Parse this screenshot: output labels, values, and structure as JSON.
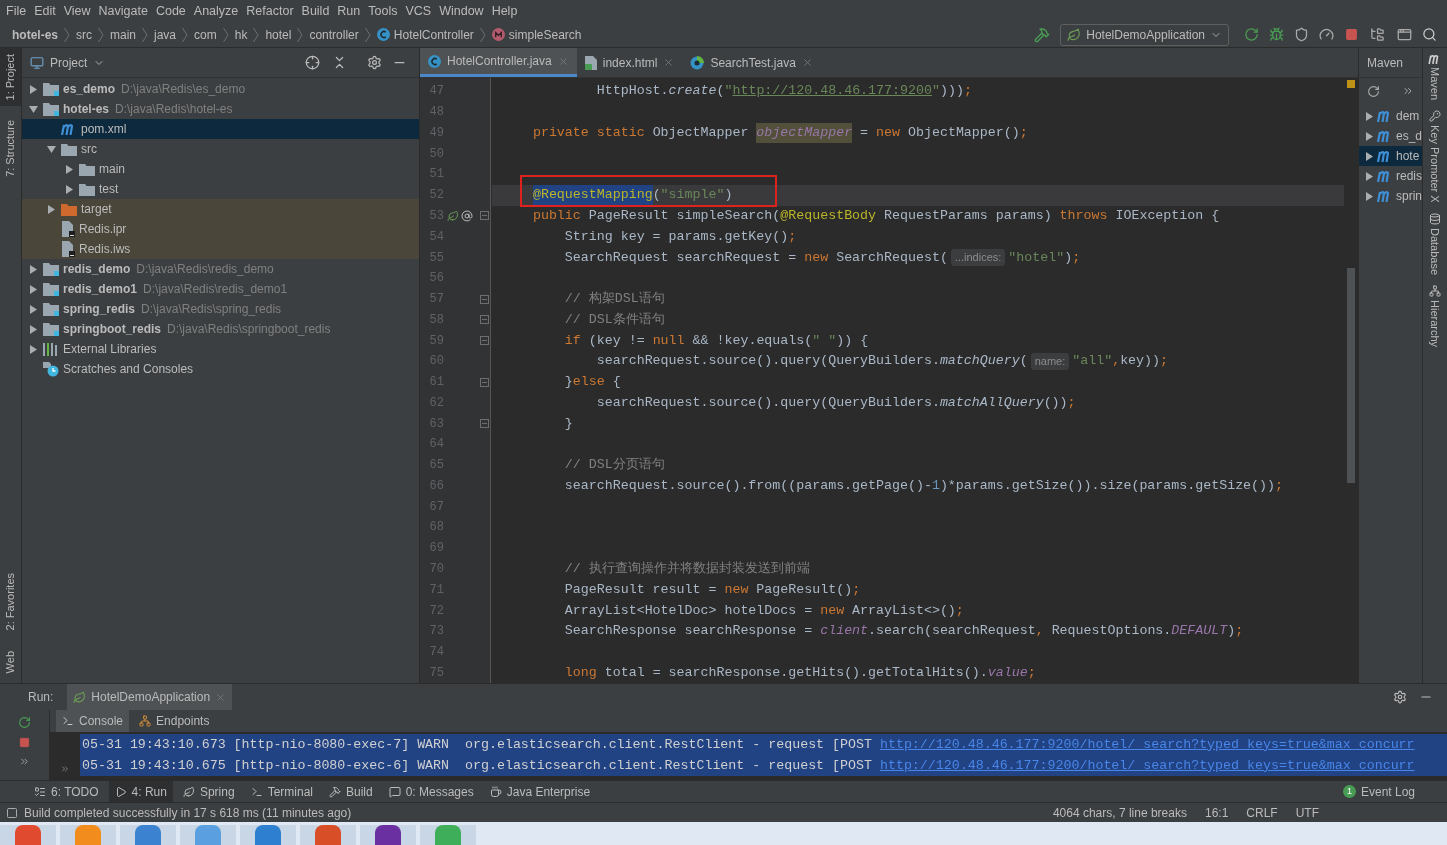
{
  "menu": [
    "File",
    "Edit",
    "View",
    "Navigate",
    "Code",
    "Analyze",
    "Refactor",
    "Build",
    "Run",
    "Tools",
    "VCS",
    "Window",
    "Help"
  ],
  "breadcrumbs": [
    {
      "label": "hotel-es",
      "kind": "module"
    },
    {
      "label": "src",
      "kind": "folder"
    },
    {
      "label": "main",
      "kind": "folder"
    },
    {
      "label": "java",
      "kind": "folder"
    },
    {
      "label": "com",
      "kind": "folder"
    },
    {
      "label": "hk",
      "kind": "folder"
    },
    {
      "label": "hotel",
      "kind": "folder"
    },
    {
      "label": "controller",
      "kind": "folder"
    },
    {
      "label": "HotelController",
      "kind": "class"
    },
    {
      "label": "simpleSearch",
      "kind": "method"
    }
  ],
  "run_config": {
    "label": "HotelDemoApplication"
  },
  "left_stripe_top": [
    {
      "label": "1: Project",
      "selected": true
    },
    {
      "label": "7: Structure",
      "selected": false
    }
  ],
  "left_stripe_bottom": [
    {
      "label": "2: Favorites",
      "selected": false
    },
    {
      "label": "Web",
      "selected": false
    }
  ],
  "project_panel": {
    "title": "Project",
    "tree": [
      {
        "name": "es_demo",
        "path": "D:\\java\\Redis\\es_demo",
        "kind": "module",
        "expanded": false,
        "selected": false,
        "highlighted": false
      },
      {
        "name": "hotel-es",
        "path": "D:\\java\\Redis\\hotel-es",
        "kind": "module",
        "expanded": true,
        "selected": false,
        "highlighted": false,
        "children": [
          {
            "name": "pom.xml",
            "kind": "maven",
            "selected": true,
            "highlighted": false
          },
          {
            "name": "src",
            "kind": "folder",
            "expanded": true,
            "selected": false,
            "highlighted": false,
            "children": [
              {
                "name": "main",
                "kind": "folder",
                "expanded": false,
                "selected": false,
                "highlighted": false
              },
              {
                "name": "test",
                "kind": "folder",
                "expanded": false,
                "selected": false,
                "highlighted": false
              }
            ]
          },
          {
            "name": "target",
            "kind": "excluded_folder",
            "expanded": false,
            "selected": false,
            "highlighted": true
          },
          {
            "name": "Redis.ipr",
            "kind": "ide_file",
            "selected": false,
            "highlighted": true
          },
          {
            "name": "Redis.iws",
            "kind": "ide_file",
            "selected": false,
            "highlighted": true
          }
        ]
      },
      {
        "name": "redis_demo",
        "path": "D:\\java\\Redis\\redis_demo",
        "kind": "module",
        "expanded": false,
        "selected": false,
        "highlighted": false
      },
      {
        "name": "redis_demo1",
        "path": "D:\\java\\Redis\\redis_demo1",
        "kind": "module",
        "expanded": false,
        "selected": false,
        "highlighted": false
      },
      {
        "name": "spring_redis",
        "path": "D:\\java\\Redis\\spring_redis",
        "kind": "module",
        "expanded": false,
        "selected": false,
        "highlighted": false
      },
      {
        "name": "springboot_redis",
        "path": "D:\\java\\Redis\\springboot_redis",
        "kind": "module",
        "expanded": false,
        "selected": false,
        "highlighted": false
      },
      {
        "name": "External Libraries",
        "kind": "libraries",
        "expanded": false,
        "selected": false,
        "highlighted": false
      },
      {
        "name": "Scratches and Consoles",
        "kind": "scratches",
        "selected": false,
        "highlighted": false
      }
    ]
  },
  "editor": {
    "tabs": [
      {
        "label": "HotelController.java",
        "kind": "class",
        "selected": true
      },
      {
        "label": "index.html",
        "kind": "html",
        "selected": false
      },
      {
        "label": "SearchTest.java",
        "kind": "test",
        "selected": false
      }
    ],
    "lines": [
      {
        "number": "47",
        "current": false,
        "fold": false,
        "tokens": [
          {
            "kind": "plain",
            "text": "            HttpHost."
          },
          {
            "kind": "italic",
            "text": "create"
          },
          {
            "kind": "plain",
            "text": "("
          },
          {
            "kind": "string",
            "text": "\""
          },
          {
            "kind": "url",
            "text": "http://120.48.46.177:9200"
          },
          {
            "kind": "string",
            "text": "\""
          },
          {
            "kind": "plain",
            "text": ")))"
          },
          {
            "kind": "keyword",
            "text": ";"
          }
        ]
      },
      {
        "number": "48",
        "current": false,
        "fold": false
      },
      {
        "number": "49",
        "current": false,
        "fold": false,
        "tokens": [
          {
            "kind": "keyword",
            "text": "    private static "
          },
          {
            "kind": "plain",
            "text": "ObjectMapper "
          },
          {
            "kind": "field_highlight",
            "text": "objectMapper"
          },
          {
            "kind": "plain",
            "text": " = "
          },
          {
            "kind": "keyword",
            "text": "new "
          },
          {
            "kind": "plain",
            "text": "ObjectMapper()"
          },
          {
            "kind": "keyword",
            "text": ";"
          }
        ]
      },
      {
        "number": "50",
        "current": false,
        "fold": false
      },
      {
        "number": "51",
        "current": false,
        "fold": false
      },
      {
        "number": "52",
        "current": true,
        "fold": false,
        "tokens": [
          {
            "kind": "annotation_selected",
            "text": "    @RequestMapping"
          },
          {
            "kind": "plain",
            "text": "("
          },
          {
            "kind": "string",
            "text": "\"simple\""
          },
          {
            "kind": "plain",
            "text": ")"
          }
        ]
      },
      {
        "number": "53",
        "current": false,
        "fold": true,
        "markers": true,
        "tokens": [
          {
            "kind": "keyword",
            "text": "    public "
          },
          {
            "kind": "plain",
            "text": "PageResult simpleSearch("
          },
          {
            "kind": "annotation",
            "text": "@RequestBody"
          },
          {
            "kind": "plain",
            "text": " RequestParams params) "
          },
          {
            "kind": "keyword",
            "text": "throws "
          },
          {
            "kind": "plain",
            "text": "IOException {"
          }
        ]
      },
      {
        "number": "54",
        "current": false,
        "fold": false,
        "tokens": [
          {
            "kind": "plain",
            "text": "        String key = params.getKey()"
          },
          {
            "kind": "keyword",
            "text": ";"
          }
        ]
      },
      {
        "number": "55",
        "current": false,
        "fold": false,
        "tokens": [
          {
            "kind": "plain",
            "text": "        SearchRequest searchRequest = "
          },
          {
            "kind": "keyword",
            "text": "new "
          },
          {
            "kind": "plain",
            "text": "SearchRequest("
          },
          {
            "kind": "hint",
            "text": "...indices:"
          },
          {
            "kind": "string",
            "text": "\"hotel\""
          },
          {
            "kind": "plain",
            "text": ")"
          },
          {
            "kind": "keyword",
            "text": ";"
          }
        ]
      },
      {
        "number": "56",
        "current": false,
        "fold": false
      },
      {
        "number": "57",
        "current": false,
        "fold": true,
        "tokens": [
          {
            "kind": "comment",
            "text": "        // 构架DSL语句"
          }
        ]
      },
      {
        "number": "58",
        "current": false,
        "fold": true,
        "tokens": [
          {
            "kind": "comment",
            "text": "        // DSL条件语句"
          }
        ]
      },
      {
        "number": "59",
        "current": false,
        "fold": true,
        "tokens": [
          {
            "kind": "keyword",
            "text": "        if "
          },
          {
            "kind": "plain",
            "text": "(key != "
          },
          {
            "kind": "keyword",
            "text": "null "
          },
          {
            "kind": "plain",
            "text": "&& !key.equals("
          },
          {
            "kind": "string",
            "text": "\" \""
          },
          {
            "kind": "plain",
            "text": ")) {"
          }
        ]
      },
      {
        "number": "60",
        "current": false,
        "fold": false,
        "tokens": [
          {
            "kind": "plain",
            "text": "            searchRequest.source().query(QueryBuilders."
          },
          {
            "kind": "italic",
            "text": "matchQuery"
          },
          {
            "kind": "plain",
            "text": "("
          },
          {
            "kind": "hint",
            "text": "name:"
          },
          {
            "kind": "string",
            "text": "\"all\""
          },
          {
            "kind": "keyword",
            "text": ","
          },
          {
            "kind": "plain",
            "text": "key))"
          },
          {
            "kind": "keyword",
            "text": ";"
          }
        ]
      },
      {
        "number": "61",
        "current": false,
        "fold": true,
        "tokens": [
          {
            "kind": "plain",
            "text": "        }"
          },
          {
            "kind": "keyword",
            "text": "else "
          },
          {
            "kind": "plain",
            "text": "{"
          }
        ]
      },
      {
        "number": "62",
        "current": false,
        "fold": false,
        "tokens": [
          {
            "kind": "plain",
            "text": "            searchRequest.source().query(QueryBuilders."
          },
          {
            "kind": "italic",
            "text": "matchAllQuery"
          },
          {
            "kind": "plain",
            "text": "())"
          },
          {
            "kind": "keyword",
            "text": ";"
          }
        ]
      },
      {
        "number": "63",
        "current": false,
        "fold": true,
        "tokens": [
          {
            "kind": "plain",
            "text": "        }"
          }
        ]
      },
      {
        "number": "64",
        "current": false,
        "fold": false
      },
      {
        "number": "65",
        "current": false,
        "fold": false,
        "tokens": [
          {
            "kind": "comment",
            "text": "        // DSL分页语句"
          }
        ]
      },
      {
        "number": "66",
        "current": false,
        "fold": false,
        "tokens": [
          {
            "kind": "plain",
            "text": "        searchRequest.source().from((params.getPage()-"
          },
          {
            "kind": "number",
            "text": "1"
          },
          {
            "kind": "plain",
            "text": ")*params.getSize()).size(params.getSize())"
          },
          {
            "kind": "keyword",
            "text": ";"
          }
        ]
      },
      {
        "number": "67",
        "current": false,
        "fold": false
      },
      {
        "number": "68",
        "current": false,
        "fold": false
      },
      {
        "number": "69",
        "current": false,
        "fold": false
      },
      {
        "number": "70",
        "current": false,
        "fold": false,
        "tokens": [
          {
            "kind": "comment",
            "text": "        // 执行查询操作并将数据封装发送到前端"
          }
        ]
      },
      {
        "number": "71",
        "current": false,
        "fold": false,
        "tokens": [
          {
            "kind": "plain",
            "text": "        PageResult result = "
          },
          {
            "kind": "keyword",
            "text": "new "
          },
          {
            "kind": "plain",
            "text": "PageResult()"
          },
          {
            "kind": "keyword",
            "text": ";"
          }
        ]
      },
      {
        "number": "72",
        "current": false,
        "fold": false,
        "tokens": [
          {
            "kind": "plain",
            "text": "        ArrayList<HotelDoc> hotelDocs = "
          },
          {
            "kind": "keyword",
            "text": "new "
          },
          {
            "kind": "plain",
            "text": "ArrayList<>()"
          },
          {
            "kind": "keyword",
            "text": ";"
          }
        ]
      },
      {
        "number": "73",
        "current": false,
        "fold": false,
        "tokens": [
          {
            "kind": "plain",
            "text": "        SearchResponse searchResponse = "
          },
          {
            "kind": "field",
            "text": "client"
          },
          {
            "kind": "plain",
            "text": ".search(searchRequest"
          },
          {
            "kind": "keyword",
            "text": ", "
          },
          {
            "kind": "plain",
            "text": "RequestOptions."
          },
          {
            "kind": "field",
            "text": "DEFAULT"
          },
          {
            "kind": "plain",
            "text": ")"
          },
          {
            "kind": "keyword",
            "text": ";"
          }
        ]
      },
      {
        "number": "74",
        "current": false,
        "fold": false
      },
      {
        "number": "75",
        "current": false,
        "fold": false,
        "tokens": [
          {
            "kind": "keyword",
            "text": "        long "
          },
          {
            "kind": "plain",
            "text": "total = searchResponse.getHits().getTotalHits()."
          },
          {
            "kind": "field",
            "text": "value"
          },
          {
            "kind": "keyword",
            "text": ";"
          }
        ]
      }
    ]
  },
  "maven": {
    "title": "Maven",
    "items": [
      {
        "label": "dem",
        "selected": false
      },
      {
        "label": "es_d",
        "selected": false
      },
      {
        "label": "hote",
        "selected": true
      },
      {
        "label": "redis",
        "selected": false
      },
      {
        "label": "sprin",
        "selected": false
      }
    ]
  },
  "right_stripe": [
    {
      "label": "Maven",
      "kind": "maven"
    },
    {
      "label": "Key Promoter X",
      "kind": "key"
    },
    {
      "label": "Database",
      "kind": "database"
    },
    {
      "label": "Hierarchy",
      "kind": "hierarchy"
    }
  ],
  "run_panel": {
    "label": "Run:",
    "tabs": [
      {
        "label": "HotelDemoApplication",
        "selected": true
      }
    ],
    "subtabs": [
      {
        "label": "Console",
        "kind": "console",
        "selected": true
      },
      {
        "label": "Endpoints",
        "kind": "endpoints",
        "selected": false
      }
    ],
    "lines": [
      {
        "text": "05-31 19:43:10.673 [http-nio-8080-exec-7] WARN  org.elasticsearch.client.RestClient - request [POST ",
        "link": "http://120.48.46.177:9200/hotel/_search?typed_keys=true&max_concurr",
        "selected": true
      },
      {
        "text": "05-31 19:43:10.675 [http-nio-8080-exec-6] WARN  org.elasticsearch.client.RestClient - request [POST ",
        "link": "http://120.48.46.177:9200/hotel/_search?typed_keys=true&max_concurr",
        "selected": true
      }
    ]
  },
  "tool_windows": [
    {
      "label": "6: TODO",
      "kind": "todo",
      "selected": false
    },
    {
      "label": "4: Run",
      "kind": "run",
      "selected": true
    },
    {
      "label": "Spring",
      "kind": "spring",
      "selected": false
    },
    {
      "label": "Terminal",
      "kind": "terminal",
      "selected": false
    },
    {
      "label": "Build",
      "kind": "build",
      "selected": false
    },
    {
      "label": "0: Messages",
      "kind": "messages",
      "selected": false
    },
    {
      "label": "Java Enterprise",
      "kind": "javaee",
      "selected": false
    }
  ],
  "event_log": {
    "label": "Event Log",
    "badge": "1"
  },
  "status": {
    "message": "Build completed successfully in 17 s 618 ms (11 minutes ago)",
    "info": [
      "4064 chars, 7 line breaks",
      "16:1",
      "CRLF",
      "UTF"
    ]
  }
}
